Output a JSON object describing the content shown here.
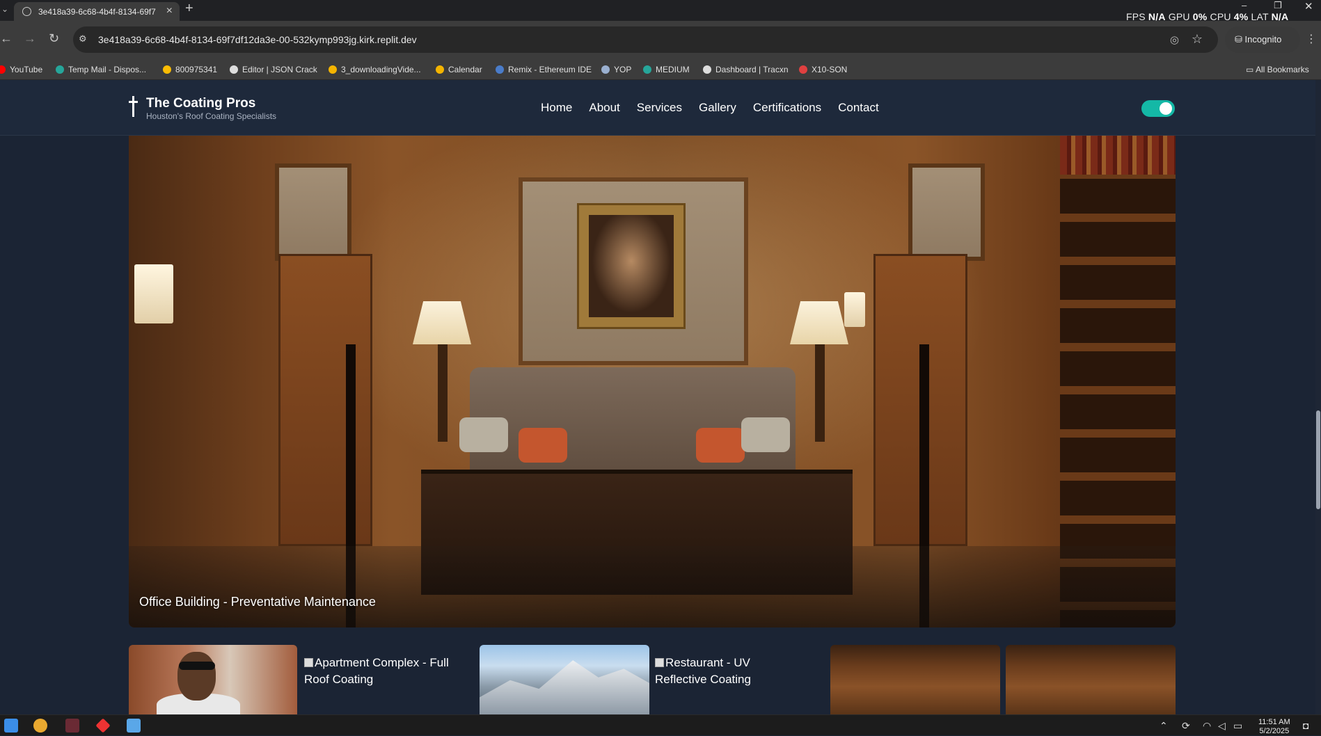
{
  "browser": {
    "tab_title": "3e418a39-6c68-4b4f-8134-69f7",
    "url": "3e418a39-6c68-4b4f-8134-69f7df12da3e-00-532kymp993jg.kirk.replit.dev",
    "incognito_label": "Incognito",
    "perf": {
      "fps_label": "FPS",
      "fps_value": "N/A",
      "gpu_label": "GPU",
      "gpu_value": "0%",
      "cpu_label": "CPU",
      "cpu_value": "4%",
      "lat_label": "LAT",
      "lat_value": "N/A"
    },
    "bookmarks": [
      {
        "label": "YouTube",
        "color": "#ff0000"
      },
      {
        "label": "Temp Mail - Dispos...",
        "color": "#26a69a"
      },
      {
        "label": "800975341",
        "color": "#fbbc04"
      },
      {
        "label": "Editor | JSON Crack",
        "color": "#dddddd"
      },
      {
        "label": "3_downloadingVide...",
        "color": "#f4b400"
      },
      {
        "label": "Calendar",
        "color": "#f4b400"
      },
      {
        "label": "Remix - Ethereum IDE",
        "color": "#4a7cc9"
      },
      {
        "label": "YOP",
        "color": "#9ab0d0"
      },
      {
        "label": "MEDIUM",
        "color": "#26a69a"
      },
      {
        "label": "Dashboard | Tracxn",
        "color": "#dddddd"
      },
      {
        "label": "X10-SON",
        "color": "#e04040"
      }
    ],
    "all_bookmarks": "All Bookmarks"
  },
  "site": {
    "brand": "The Coating Pros",
    "tagline": "Houston's Roof Coating Specialists",
    "nav": [
      "Home",
      "About",
      "Services",
      "Gallery",
      "Certifications",
      "Contact"
    ],
    "theme_toggle_on": true,
    "accent_color": "#14b8a6"
  },
  "gallery": {
    "hero_caption": "Office Building - Preventative Maintenance",
    "thumbnails": [
      {
        "type": "image",
        "name": "thumb-portrait"
      },
      {
        "type": "broken",
        "alt": "Apartment Complex - Full Roof Coating"
      },
      {
        "type": "image",
        "name": "thumb-mountain"
      },
      {
        "type": "broken",
        "alt": "Restaurant - UV Reflective Coating"
      },
      {
        "type": "image",
        "name": "thumb-interior-1"
      },
      {
        "type": "image",
        "name": "thumb-interior-2"
      }
    ]
  },
  "taskbar": {
    "time": "11:51 AM",
    "date": "5/2/2025"
  }
}
